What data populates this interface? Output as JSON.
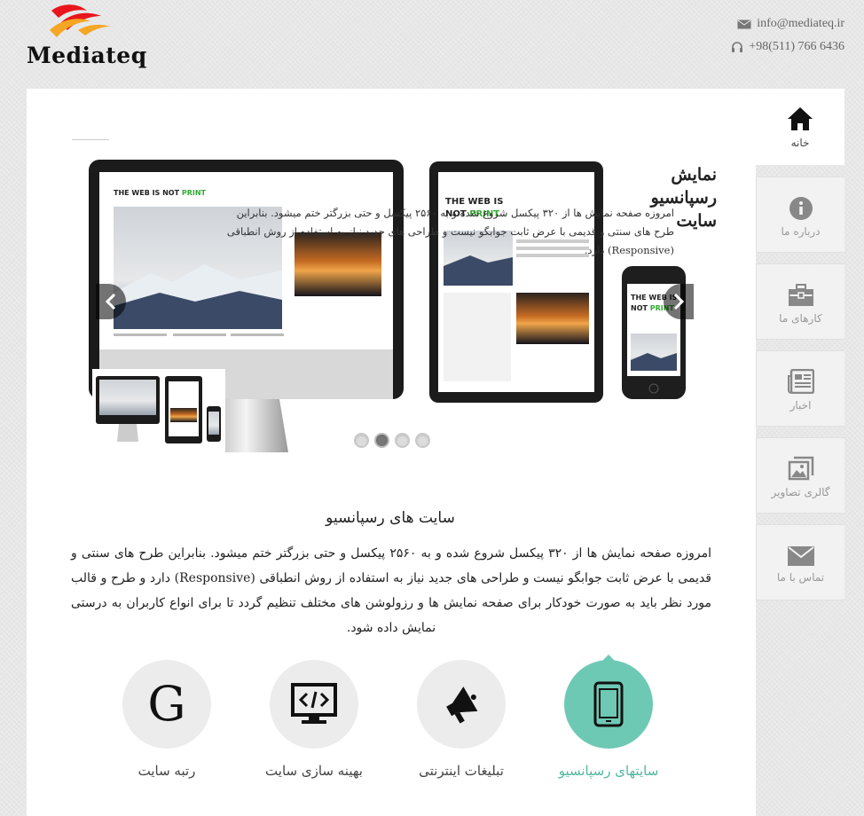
{
  "brand": {
    "name": "Mediateq"
  },
  "contact": {
    "email": "info@mediateq.ir",
    "phone": "+98(511) 766 6436"
  },
  "nav": [
    {
      "label": "خانه",
      "icon": "home-icon",
      "active": true
    },
    {
      "label": "درباره ما",
      "icon": "info-icon"
    },
    {
      "label": "کارهای ما",
      "icon": "briefcase-icon"
    },
    {
      "label": "اخبار",
      "icon": "newspaper-icon"
    },
    {
      "label": "گالری تصاویر",
      "icon": "gallery-icon"
    },
    {
      "label": "تماس با ما",
      "icon": "envelope-icon"
    }
  ],
  "slider": {
    "title": "نمایش رسپانسیو سایت",
    "text": "امروزه صفحه نمایش ها از ۳۲۰ پیکسل شروع شده و به ۲۵۶۰ پیکسل و حتی بزرگتر ختم میشود. بنابراین طرح های سنتی و قدیمی با عرض ثابت جوابگو نیست و طراحی های جدید نیاز به استفاده از روش انطباقی (Responsive) دارد.",
    "device_headline": "THE WEB IS NOT PRINT",
    "dots": 4,
    "active_dot": 2
  },
  "section": {
    "title": "سایت های رسپانسیو",
    "body": "امروزه صفحه نمایش ها از ۳۲۰ پیکسل شروع شده و به ۲۵۶۰ پیکسل و حتی بزرگتر ختم میشود. بنابراین طرح های سنتی و قدیمی با عرض ثابت جوابگو نیست و طراحی های جدید نیاز به استفاده از روش انطباقی (Responsive) دارد و طرح و قالب مورد نظر باید به صورت خودکار برای صفحه نمایش ها و رزولوشن های مختلف تنظیم گردد تا برای انواع کاربران به درستی نمایش داده شود."
  },
  "features": [
    {
      "label": "رتبه سایت",
      "icon": "google-icon",
      "glyph": "G"
    },
    {
      "label": "بهینه سازی سایت",
      "icon": "code-monitor-icon"
    },
    {
      "label": "تبلیغات اینترنتی",
      "icon": "megaphone-icon"
    },
    {
      "label": "سایتهای رسپانسیو",
      "icon": "mobile-icon",
      "active": true
    }
  ],
  "colors": {
    "accent": "#6ec9b4",
    "accent_text": "#52b69f"
  }
}
